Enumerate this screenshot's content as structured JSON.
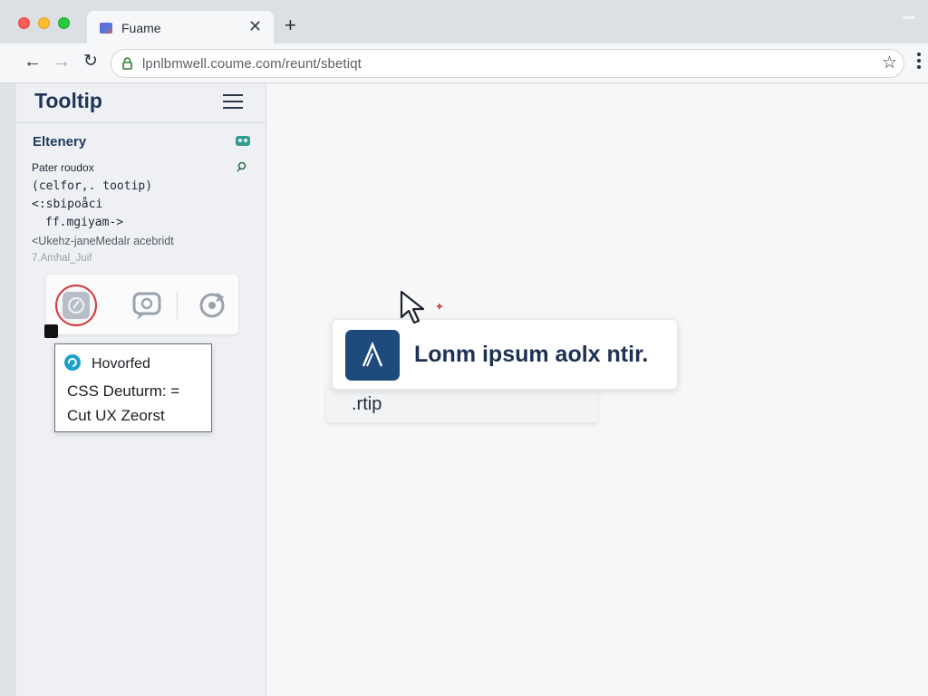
{
  "browser": {
    "tab_title": "Fuame",
    "tab_close": "✕",
    "new_tab": "+",
    "nav": {
      "back": "←",
      "forward": "→",
      "reload": "↻"
    },
    "url": "lpnlbmwell.coume.com/reunt/sbetiqt",
    "star": "☆"
  },
  "sidebar": {
    "title": "Tooltip",
    "section_title": "Eltenery",
    "code_lines": [
      "Pater roudox",
      "(celfor,. tootip)",
      "<:sbipoåci",
      "ff.mgiyam->",
      "<Ukehz-janeMedalr acebridt",
      "7.Amhal_Juif"
    ],
    "icon_buttons": [
      "hovered-tooltip-icon",
      "chat-bubble-icon",
      "refresh-icon"
    ],
    "tooltip_card": {
      "line1": "Hovorfed",
      "line2": "CSS Deuturm: =",
      "line3": "Cut UX Zeorst"
    }
  },
  "main": {
    "tooltip_text": "Lonm ipsum aolx ntir.",
    "tooltip_class": ".rtip"
  },
  "colors": {
    "accent_navy": "#1f4a7c",
    "title_text": "#1c3154",
    "hover_ring": "#d13b3b",
    "info_icon": "#1ba3c9"
  }
}
